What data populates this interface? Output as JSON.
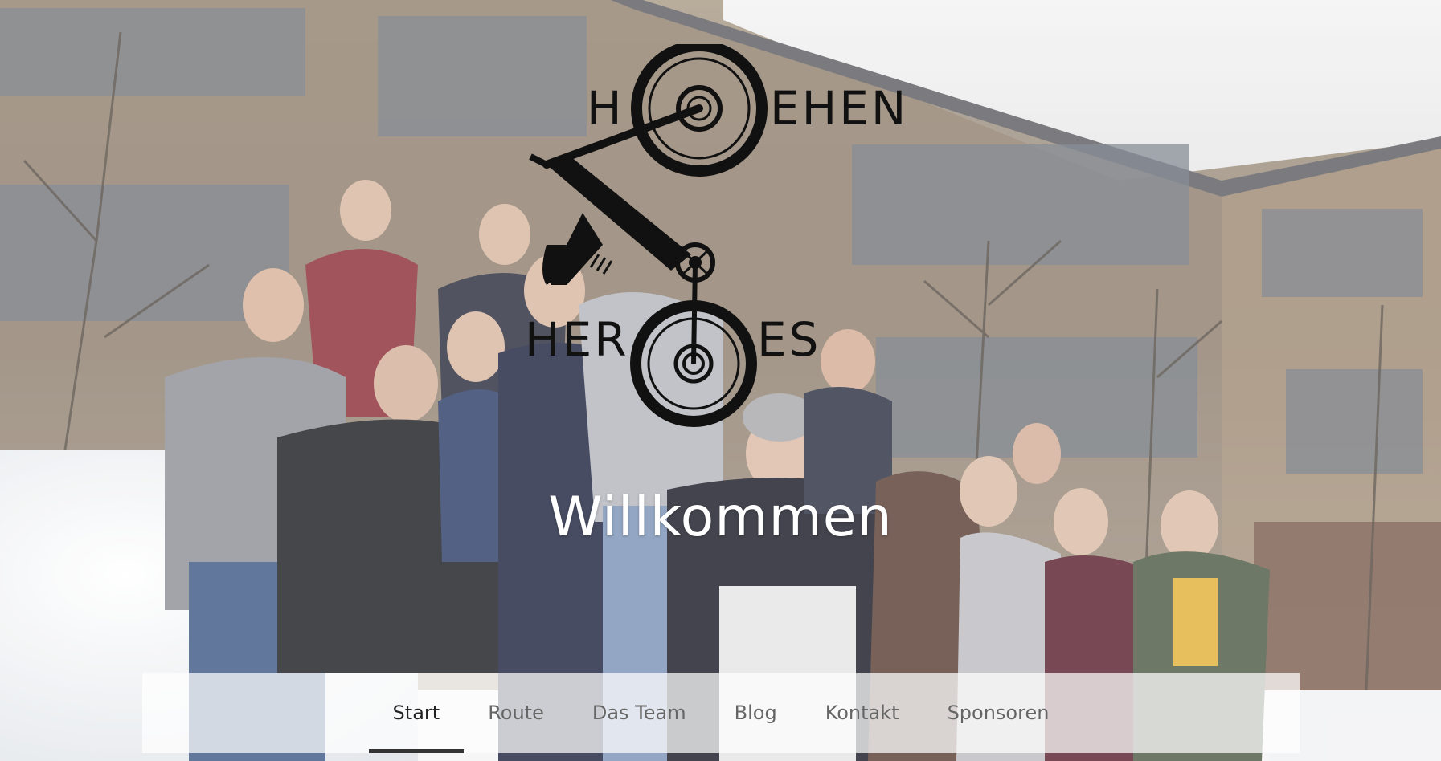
{
  "logo": {
    "line1_left": "H",
    "line1_right": "EHEN",
    "line2_left": "HER",
    "line2_right": "ES"
  },
  "hero": {
    "heading": "Willkommen"
  },
  "nav": {
    "items": [
      {
        "label": "Start",
        "active": true
      },
      {
        "label": "Route",
        "active": false
      },
      {
        "label": "Das Team",
        "active": false
      },
      {
        "label": "Blog",
        "active": false
      },
      {
        "label": "Kontakt",
        "active": false
      },
      {
        "label": "Sponsoren",
        "active": false
      }
    ]
  },
  "colors": {
    "nav_active_underline": "#333333",
    "heading_text": "#ffffff",
    "logo_ink": "#111111"
  }
}
